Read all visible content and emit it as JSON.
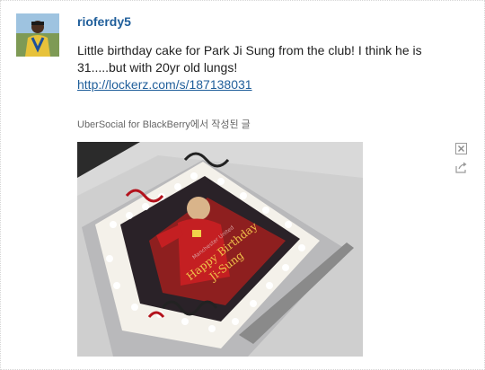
{
  "post": {
    "username": "rioferdy5",
    "text": "Little birthday cake for Park Ji Sung from the club! I think he is 31.....but with 20yr old lungs!",
    "link": "http://lockerz.com/s/187138031",
    "source": "UberSocial for BlackBerry에서 작성된 글"
  },
  "photo": {
    "cake_text_line1": "Happy Birthday",
    "cake_text_line2": "Ji-Sung",
    "cake_text_faint": "Manchester United"
  },
  "icons": {
    "close": "close-x-icon",
    "share": "share-arrow-icon"
  },
  "colors": {
    "link": "#1f5e9a",
    "text": "#222222",
    "meta": "#666666"
  }
}
